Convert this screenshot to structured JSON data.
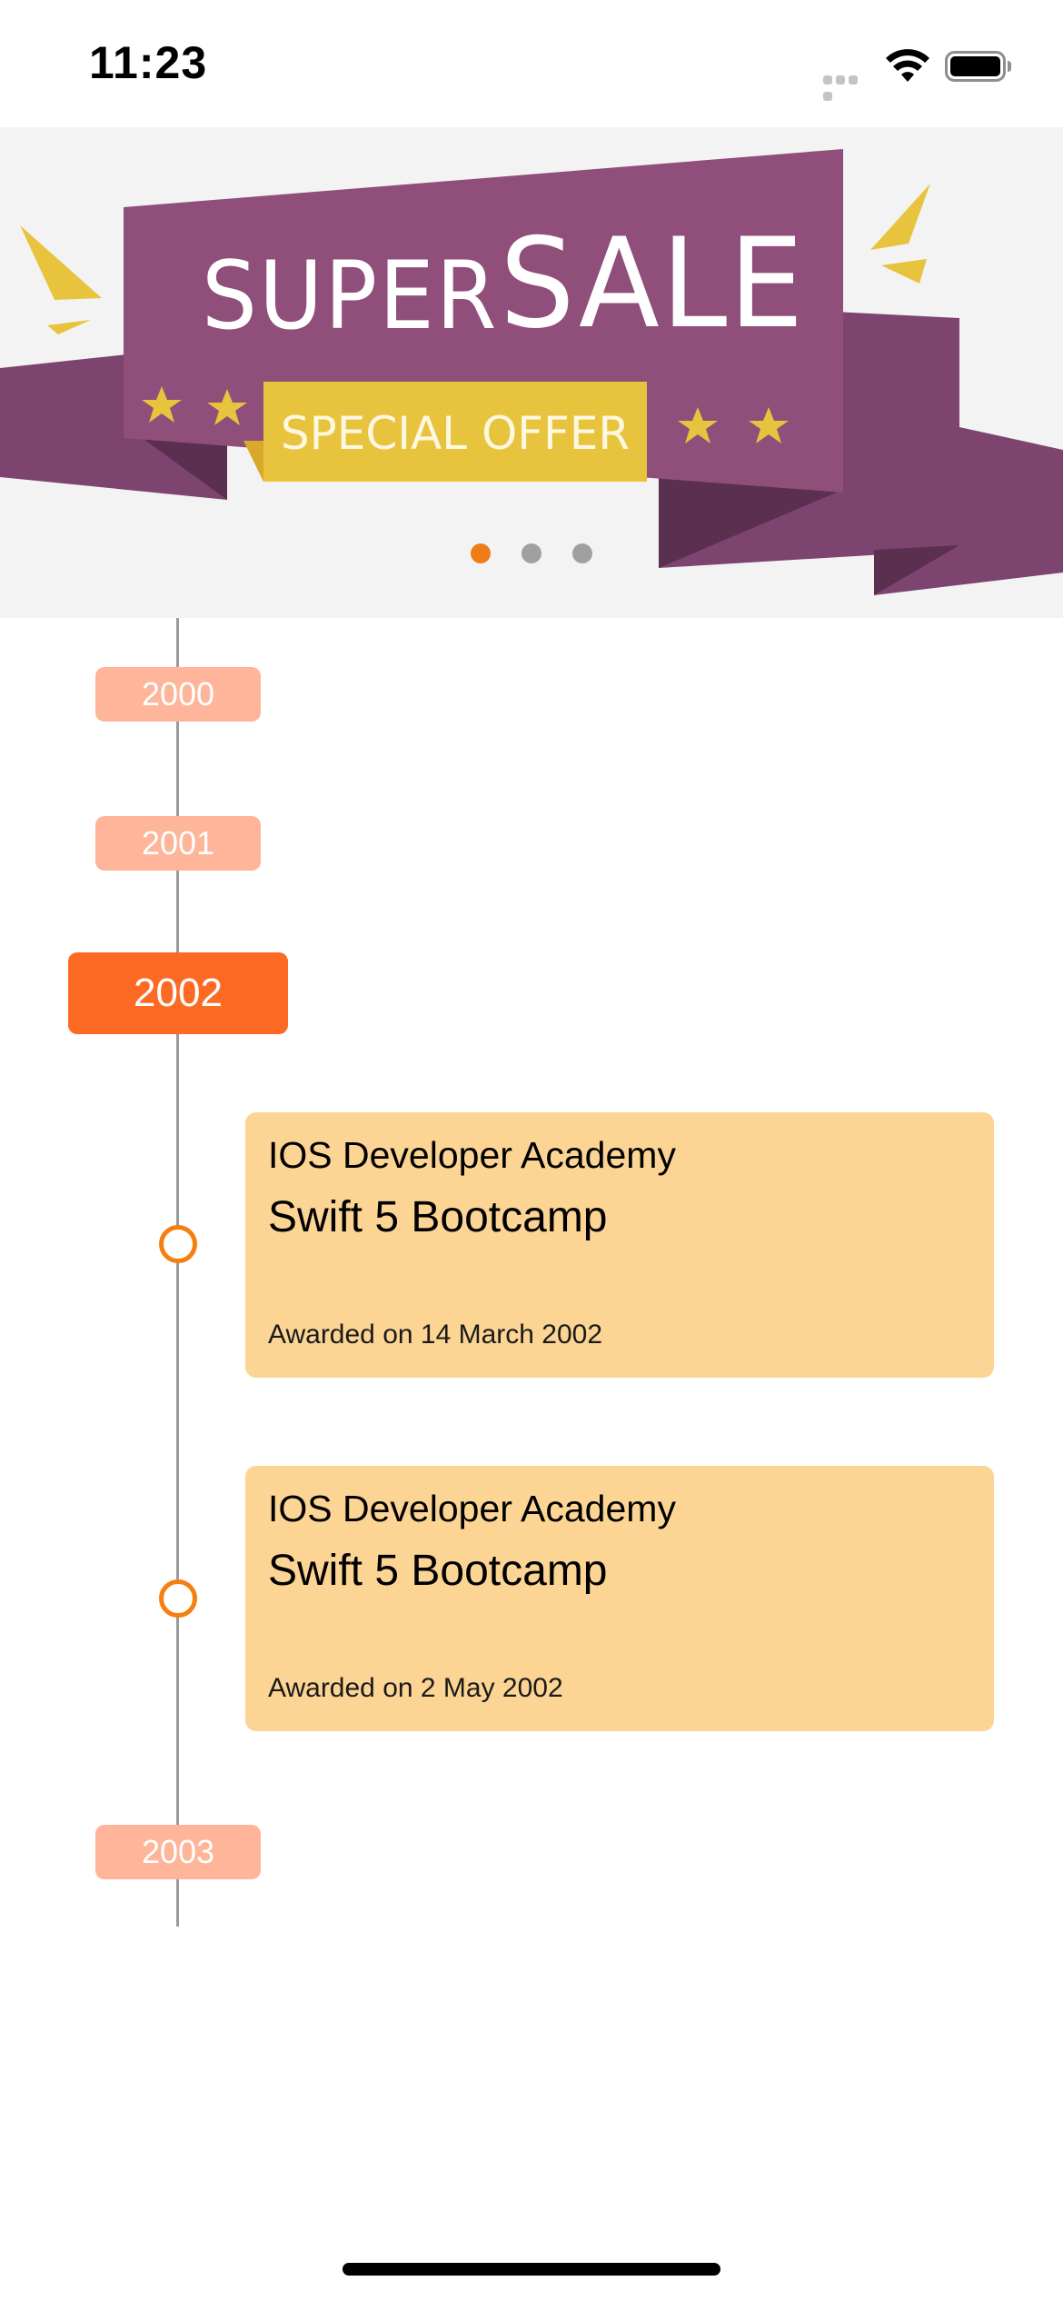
{
  "status_bar": {
    "time": "11:23",
    "icons": [
      "signal-icon",
      "wifi-icon",
      "battery-icon"
    ]
  },
  "banner": {
    "title_word_1": "SUPER",
    "title_word_2": "SALE",
    "ribbon_text": "SPECIAL OFFER",
    "pager": {
      "pages": 3,
      "active_index": 0
    },
    "colors": {
      "background": "#f3f3f3",
      "ribbon_purple": "#904e7b",
      "ribbon_dark": "#6d3a60",
      "ribbon_shadow": "#5a2f50",
      "accent_yellow": "#e8c33e"
    }
  },
  "timeline": {
    "years": [
      {
        "label": "2000",
        "selected": false
      },
      {
        "label": "2001",
        "selected": false
      },
      {
        "label": "2002",
        "selected": true
      },
      {
        "label": "2003",
        "selected": false
      }
    ],
    "entries": [
      {
        "organization": "IOS Developer Academy",
        "course": "Swift 5 Bootcamp",
        "awarded": "Awarded on 14 March 2002"
      },
      {
        "organization": "IOS Developer Academy",
        "course": "Swift 5 Bootcamp",
        "awarded": "Awarded on 2 May 2002"
      }
    ],
    "colors": {
      "year_tag": "#feb599",
      "year_tag_selected": "#fc6a24",
      "node_ring": "#f57f10",
      "card": "#fcd493",
      "line": "#9a9a9a"
    }
  }
}
